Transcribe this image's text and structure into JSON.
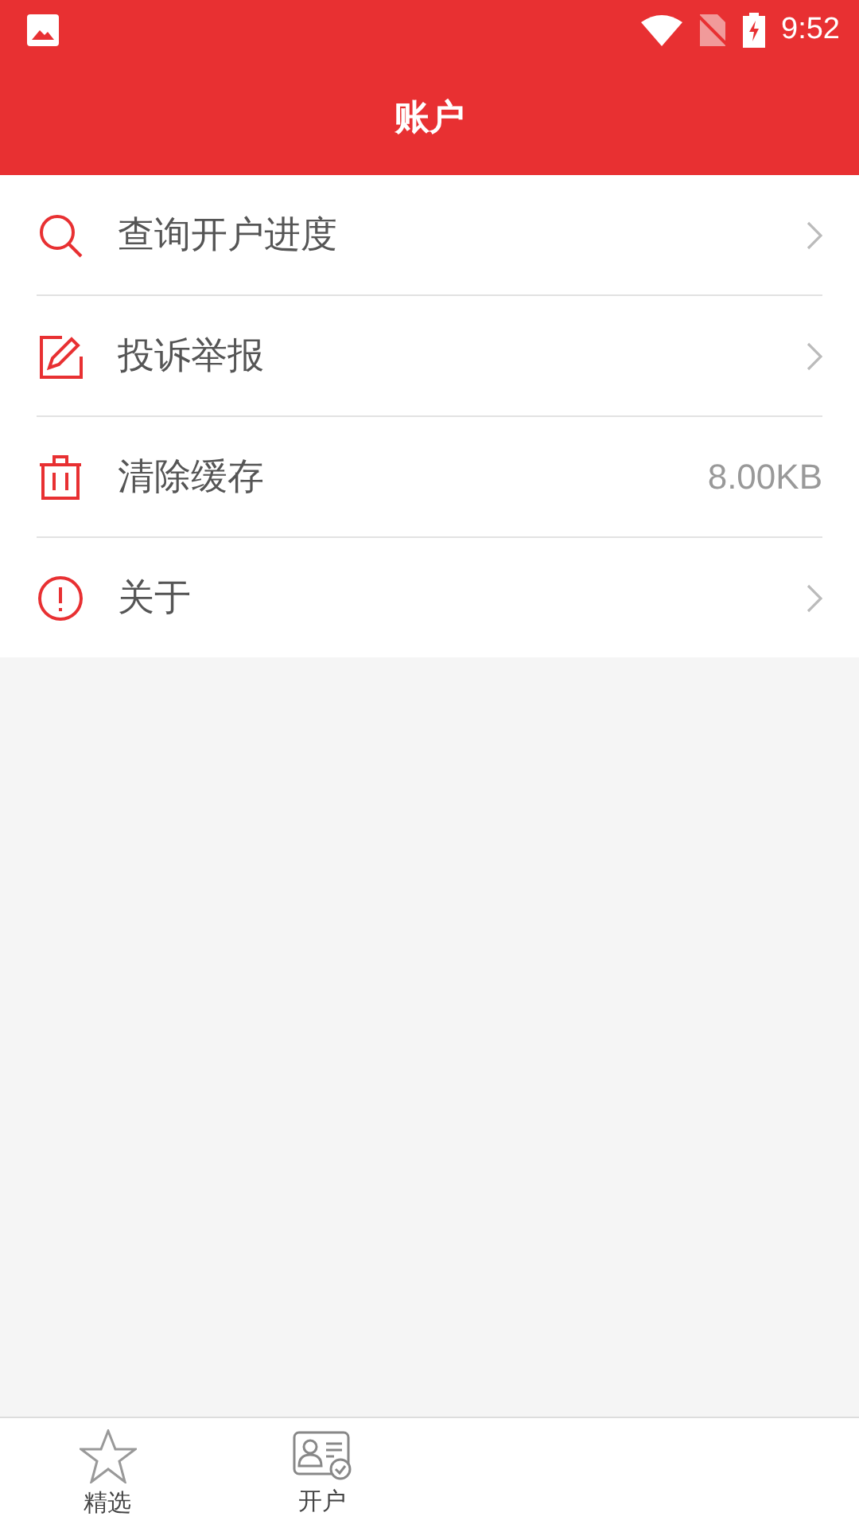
{
  "status_bar": {
    "time": "9:52"
  },
  "header": {
    "title": "账户"
  },
  "menu": [
    {
      "kind": "link",
      "label": "查询开户进度"
    },
    {
      "kind": "link",
      "label": "投诉举报"
    },
    {
      "kind": "value",
      "label": "清除缓存",
      "value": "8.00KB"
    },
    {
      "kind": "link",
      "label": "关于"
    }
  ],
  "bottom_nav": [
    {
      "label": "精选"
    },
    {
      "label": "开户"
    }
  ]
}
